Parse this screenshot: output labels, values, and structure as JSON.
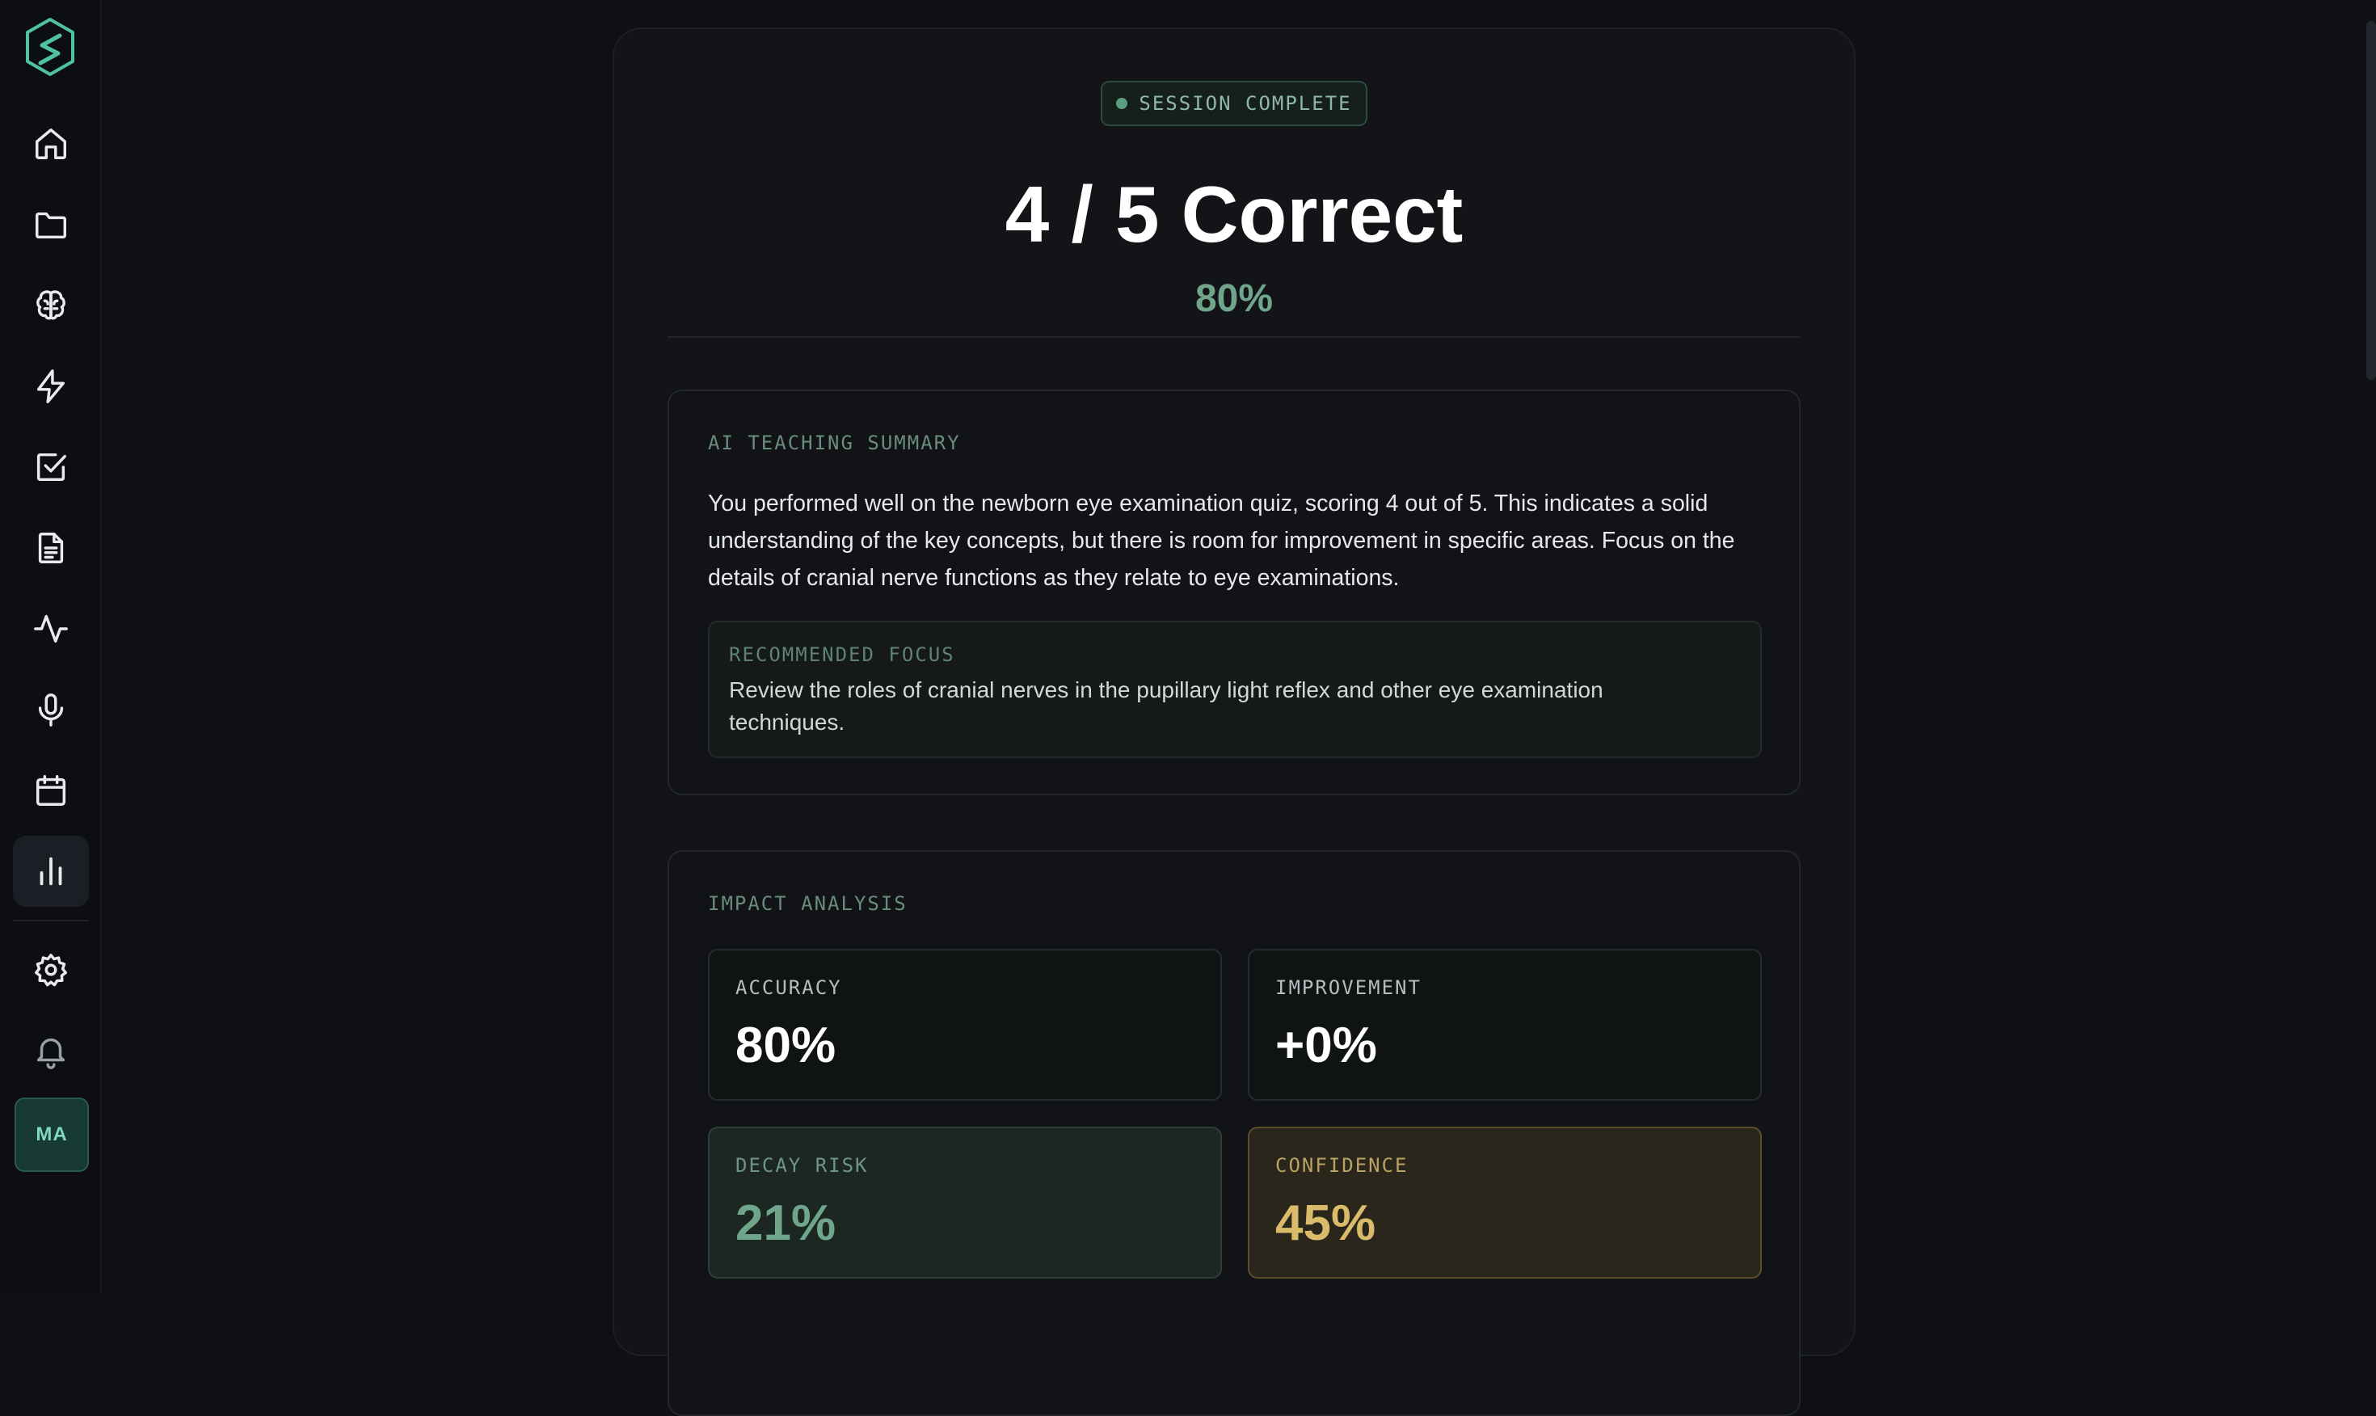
{
  "sidebar": {
    "nav": [
      {
        "icon": "home-icon"
      },
      {
        "icon": "folder-icon"
      },
      {
        "icon": "brain-icon"
      },
      {
        "icon": "lightning-icon"
      },
      {
        "icon": "checkbox-icon"
      },
      {
        "icon": "document-icon"
      },
      {
        "icon": "activity-icon"
      },
      {
        "icon": "microphone-icon"
      },
      {
        "icon": "calendar-icon"
      },
      {
        "icon": "bar-chart-icon",
        "active": true
      }
    ],
    "bottom": [
      {
        "icon": "settings-icon"
      },
      {
        "icon": "bell-icon"
      }
    ],
    "avatar_initials": "MA"
  },
  "result": {
    "badge": "SESSION COMPLETE",
    "score": "4 / 5 Correct",
    "percent": "80%"
  },
  "summary": {
    "label": "AI TEACHING SUMMARY",
    "text": "You performed well on the newborn eye examination quiz, scoring 4 out of 5. This indicates a solid understanding of the key concepts, but there is room for improvement in specific areas. Focus on the details of cranial nerve functions as they relate to eye examinations.",
    "focus_label": "RECOMMENDED FOCUS",
    "focus_text": "Review the roles of cranial nerves in the pupillary light reflex and other eye examination techniques."
  },
  "impact": {
    "label": "IMPACT ANALYSIS",
    "accuracy": {
      "label": "ACCURACY",
      "value": "80%"
    },
    "improvement": {
      "label": "IMPROVEMENT",
      "value": "+0%"
    },
    "decay_risk": {
      "label": "DECAY RISK",
      "value": "21%"
    },
    "confidence": {
      "label": "CONFIDENCE",
      "value": "45%"
    }
  },
  "colors": {
    "accent_green": "#6fa58a",
    "accent_gold": "#d9bb6a",
    "background": "#0e1014"
  }
}
